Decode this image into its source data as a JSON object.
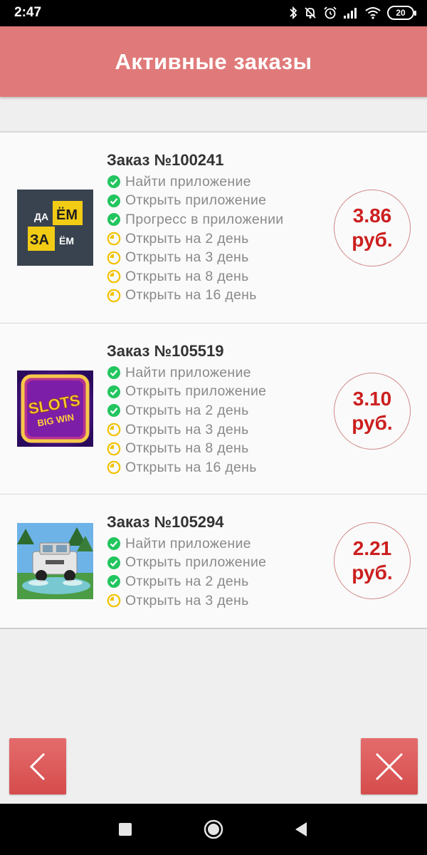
{
  "status_bar": {
    "time": "2:47",
    "battery": "20"
  },
  "header": {
    "title": "Активные заказы"
  },
  "orders": [
    {
      "title": "Заказ №100241",
      "price_value": "3.86",
      "price_unit": "руб.",
      "thumbnail": "daem-zaem-app-icon",
      "thumb_text": [
        "ДА",
        "ЁМ",
        "ЗА",
        "ЁМ"
      ],
      "tasks": [
        {
          "label": "Найти приложение",
          "status": "done"
        },
        {
          "label": "Открыть приложение",
          "status": "done"
        },
        {
          "label": "Прогресс в приложении",
          "status": "done"
        },
        {
          "label": "Открыть на 2 день",
          "status": "pending"
        },
        {
          "label": "Открыть на 3 день",
          "status": "pending"
        },
        {
          "label": "Открыть на 8 день",
          "status": "pending"
        },
        {
          "label": "Открыть на 16 день",
          "status": "pending"
        }
      ]
    },
    {
      "title": "Заказ №105519",
      "price_value": "3.10",
      "price_unit": "руб.",
      "thumbnail": "slots-big-win-app-icon",
      "thumb_text": [
        "SLOTS",
        "BIG WIN"
      ],
      "tasks": [
        {
          "label": "Найти приложение",
          "status": "done"
        },
        {
          "label": "Открыть приложение",
          "status": "done"
        },
        {
          "label": "Открыть на 2 день",
          "status": "done"
        },
        {
          "label": "Открыть на 3 день",
          "status": "pending"
        },
        {
          "label": "Открыть на 8 день",
          "status": "pending"
        },
        {
          "label": "Открыть на 16 день",
          "status": "pending"
        }
      ]
    },
    {
      "title": "Заказ №105294",
      "price_value": "2.21",
      "price_unit": "руб.",
      "thumbnail": "offroad-car-app-icon",
      "tasks": [
        {
          "label": "Найти приложение",
          "status": "done"
        },
        {
          "label": "Открыть приложение",
          "status": "done"
        },
        {
          "label": "Открыть на 2 день",
          "status": "done"
        },
        {
          "label": "Открыть на 3 день",
          "status": "pending"
        }
      ]
    }
  ],
  "buttons": {
    "back": "chevron-left-icon",
    "close": "close-icon"
  },
  "colors": {
    "header": "#e07a7a",
    "button": "#d64c4c",
    "price": "#cc1f1f",
    "done": "#22c55e",
    "pending": "#f2c200"
  }
}
